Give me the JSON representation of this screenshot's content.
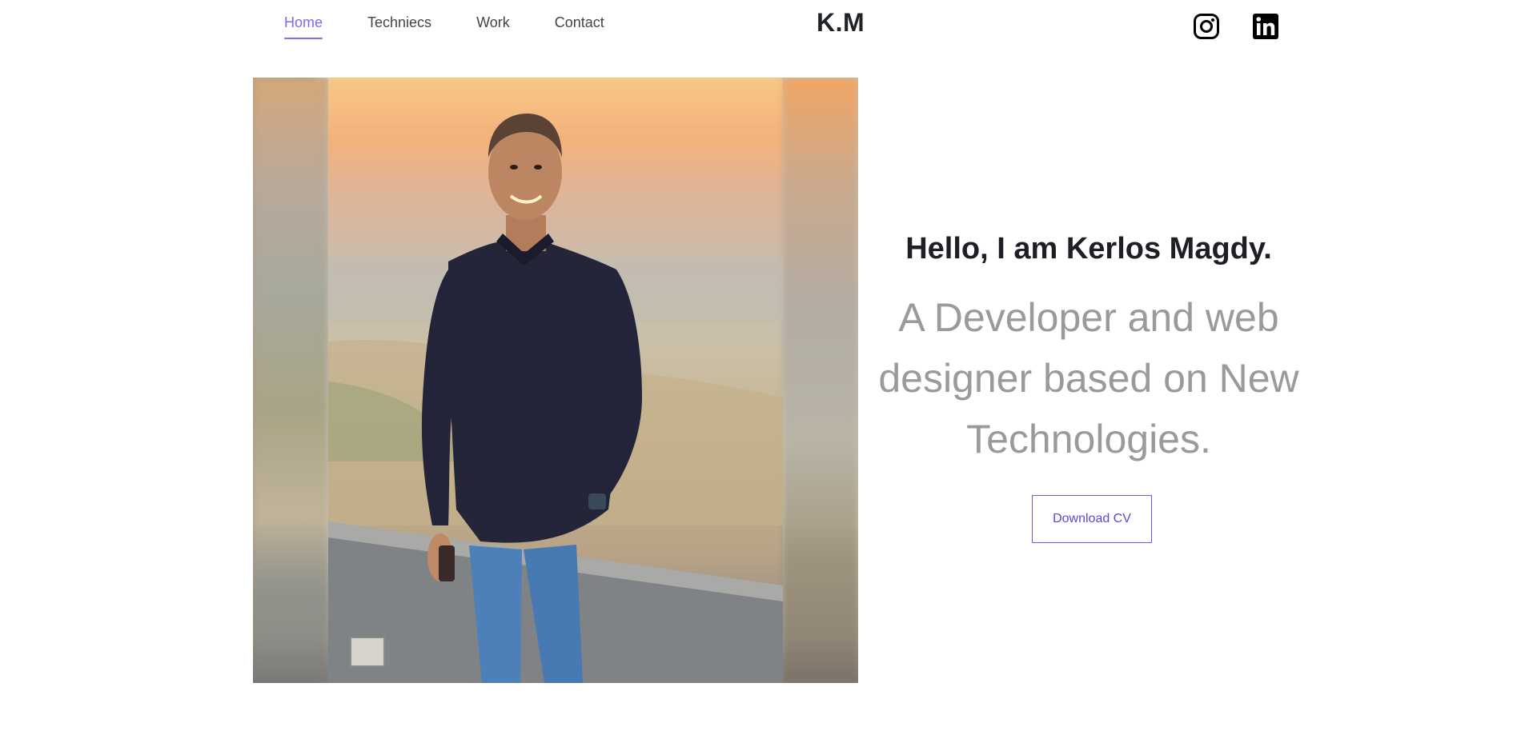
{
  "nav": {
    "items": [
      {
        "label": "Home",
        "active": true
      },
      {
        "label": "Techniecs",
        "active": false
      },
      {
        "label": "Work",
        "active": false
      },
      {
        "label": "Contact",
        "active": false
      }
    ],
    "active_color": "#7b6cf0"
  },
  "brand": {
    "text": "K.M"
  },
  "social": [
    {
      "icon": "instagram-icon"
    },
    {
      "icon": "linkedin-icon"
    }
  ],
  "hero": {
    "photo_alt": "Portrait photo",
    "greeting": "Hello, I am Kerlos Magdy.",
    "tagline": "A Developer and web designer based on New Technologies.",
    "cv_button": "Download CV",
    "accent_color": "#6d5ce8"
  }
}
